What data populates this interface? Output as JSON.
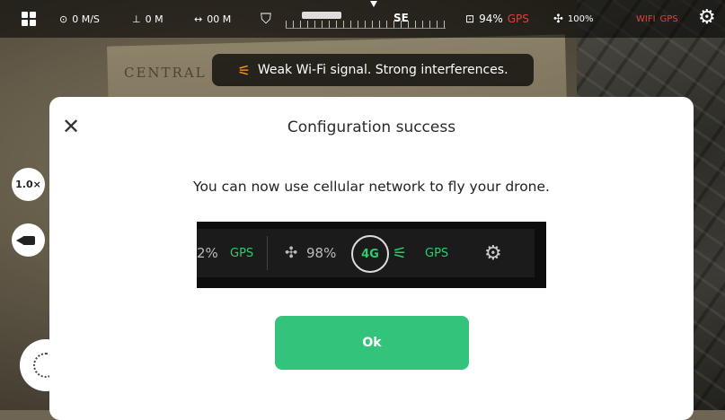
{
  "status_bar": {
    "speed": "0 M/S",
    "altitude": "0 M",
    "distance": "00 M",
    "compass_heading": "SE",
    "controller_battery": "94%",
    "gps_label": "GPS",
    "drone_battery": "100%",
    "wifi_label": "WIFI",
    "gps_label_2": "GPS"
  },
  "toast": {
    "message": "Weak Wi-Fi signal. Strong interferences."
  },
  "left_controls": {
    "zoom": "1.0×"
  },
  "modal": {
    "title": "Configuration success",
    "message": "You can now use cellular network to fly your drone.",
    "ok_label": "Ok"
  },
  "preview": {
    "partial_percent": "2%",
    "gps_label": "GPS",
    "drone_battery": "98%",
    "network_label": "4G",
    "gps_label_2": "GPS"
  },
  "background": {
    "map_text": "CENTRAL"
  },
  "colors": {
    "accent_green": "#34c37a",
    "warning_orange": "#ff9f1a",
    "alert_red": "#e04040"
  }
}
